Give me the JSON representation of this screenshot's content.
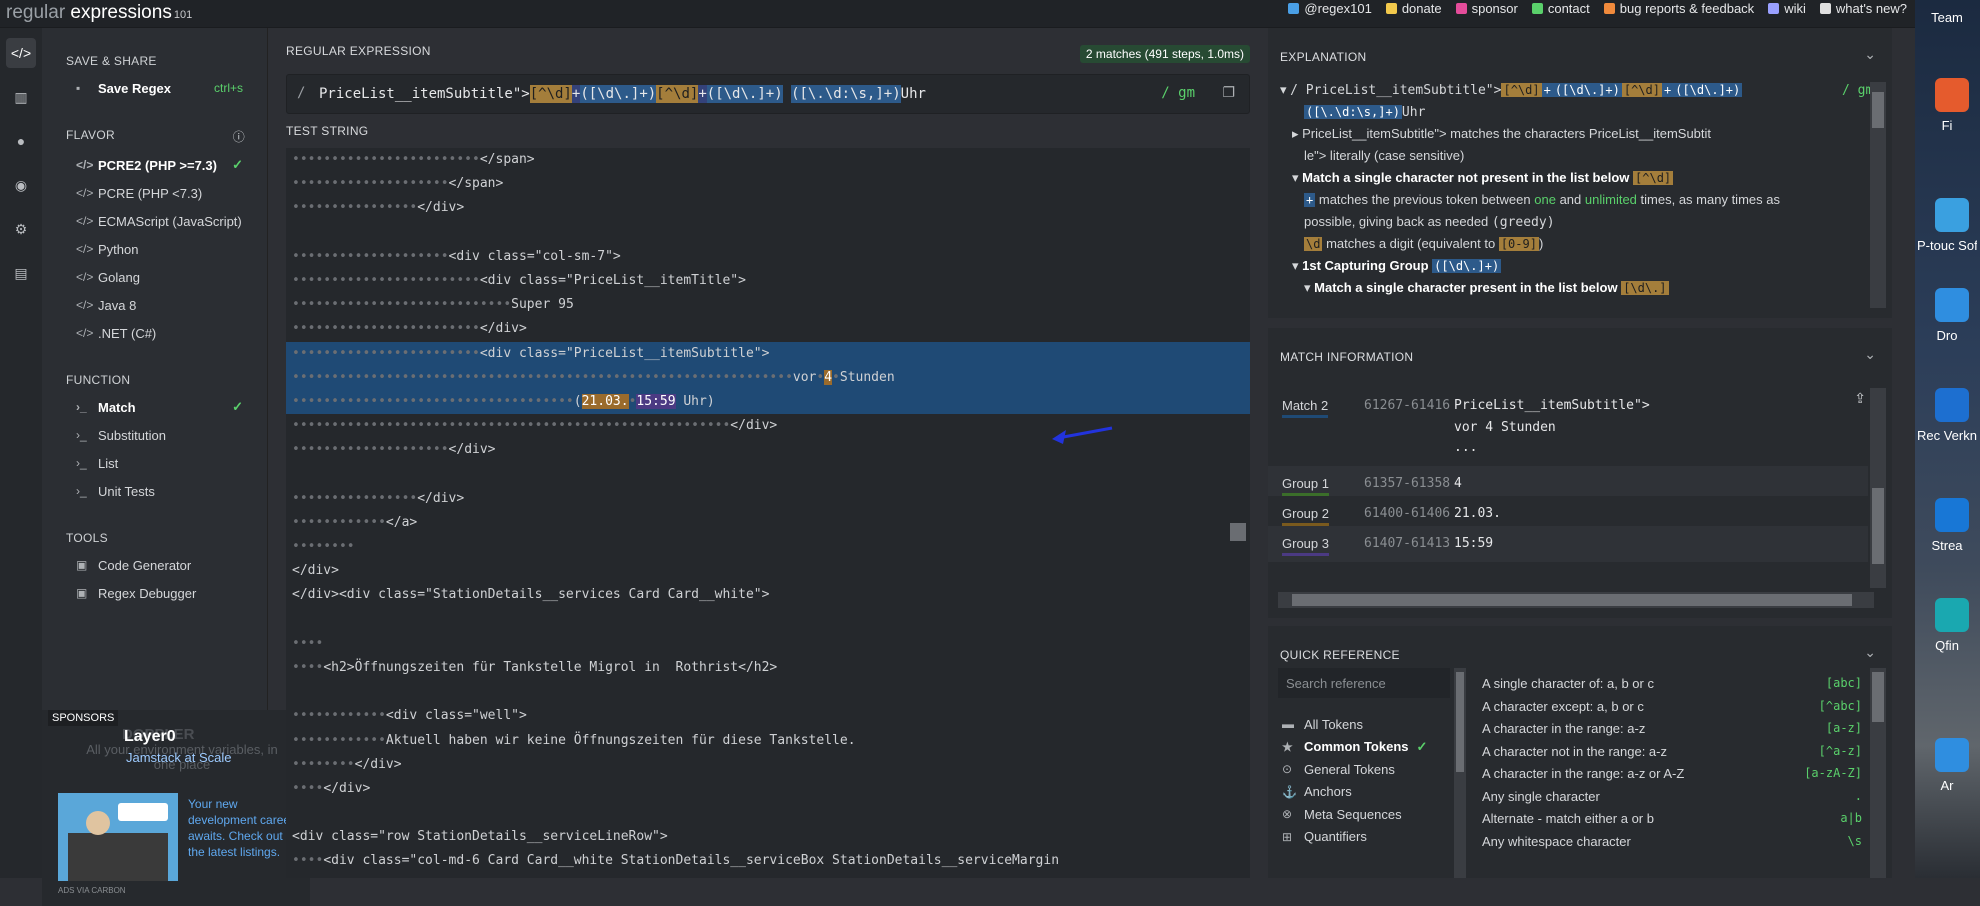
{
  "app": {
    "logo_main": "regular",
    "logo_rest": " expressions",
    "logo_ver": "101"
  },
  "toplinks": [
    {
      "label": "@regex101",
      "icon": "twitter-icon",
      "color": "#4a9fe6"
    },
    {
      "label": "donate",
      "icon": "dollar-icon",
      "color": "#f2c94c"
    },
    {
      "label": "sponsor",
      "icon": "heart-icon",
      "color": "#e44c9a"
    },
    {
      "label": "contact",
      "icon": "mail-icon",
      "color": "#5ad06b"
    },
    {
      "label": "bug reports & feedback",
      "icon": "warning-icon",
      "color": "#f08a3c"
    },
    {
      "label": "wiki",
      "icon": "book-icon",
      "color": "#9aa0ff"
    },
    {
      "label": "what's new?",
      "icon": "megaphone-icon",
      "color": "#e0e0e0"
    }
  ],
  "sidebar": {
    "save_share": "SAVE & SHARE",
    "save_regex": "Save Regex",
    "save_shortcut": "ctrl+s",
    "flavor": "FLAVOR",
    "flavors": [
      "PCRE2 (PHP >=7.3)",
      "PCRE (PHP <7.3)",
      "ECMAScript (JavaScript)",
      "Python",
      "Golang",
      "Java 8",
      ".NET (C#)"
    ],
    "function": "FUNCTION",
    "functions": [
      "Match",
      "Substitution",
      "List",
      "Unit Tests"
    ],
    "tools": "TOOLS",
    "tools_items": [
      "Code Generator",
      "Regex Debugger"
    ],
    "sponsors": "SPONSORS",
    "ad_doppler": "DOPPLER",
    "ad_doppler_text": "All your environment variables, in one place",
    "ad_layer": "Layer0",
    "ad_layer_sub": "Jamstack at Scale",
    "ad_text": "Your new development career awaits. Check out the latest listings.",
    "ad_via": "ADS VIA CARBON"
  },
  "regex": {
    "header": "REGULAR EXPRESSION",
    "badge": "2 matches (491 steps, 1.0ms)",
    "delim": "/",
    "literal": "PriceList__itemSubtitle\">",
    "tok1": "[^\\d]",
    "tok2": "+",
    "tok3": "([\\d\\.]+)",
    "tok4": "[^\\d]",
    "tok5": "+",
    "tok6": "([\\d\\.]+)",
    "tok7": "([\\.\\d:\\s,]+)",
    "tail": "Uhr",
    "flags": "/ gm"
  },
  "test": {
    "header": "TEST STRING",
    "lines": [
      "                        </span>",
      "                    </span>",
      "                </div>",
      "",
      "                    <div class=\"col-sm-7\">",
      "                        <div class=\"PriceList__itemTitle\">",
      "                            Super 95",
      "                        </div>",
      "                        <div class=\"PriceList__itemSubtitle\">",
      "                                                                vor 4 Stunden",
      "                                    (21.03. 15:59 Uhr)",
      "                                                        </div>",
      "                    </div>",
      "",
      "                </div>",
      "            </a>",
      "        ",
      "</div>",
      "</div><div class=\"StationDetails__services Card Card__white\">",
      "",
      "    ",
      "    <h2>Öffnungszeiten für Tankstelle Migrol in  Rothrist</h2>",
      "",
      "            <div class=\"well\">",
      "            Aktuell haben wir keine Öffnungszeiten für diese Tankstelle.",
      "        </div>",
      "    </div>",
      "",
      "<div class=\"row StationDetails__serviceLineRow\">",
      "    <div class=\"col-md-6 Card Card__white StationDetails__serviceBox StationDetails__serviceMargin"
    ]
  },
  "explanation": {
    "header": "EXPLANATION",
    "l1_lit": "/ PriceList__itemSubtitle\">",
    "l1_flags": "/ gm",
    "l2_tok": "([\\.\\d:\\s,]+)",
    "l2_tail": "Uhr",
    "l3": "PriceList__itemSubtitle\"> matches the characters PriceList__itemSubtit",
    "l4": "le\"> literally (case sensitive)",
    "l5": "Match a single character not present in the list below",
    "l5_tok": "[^\\d]",
    "l6_a": "matches the previous token between",
    "l6_one": "one",
    "l6_and": "and",
    "l6_unl": "unlimited",
    "l6_b": "times, as many times as",
    "l7": "possible, giving back as needed",
    "l7_g": "(greedy)",
    "l8_tok": "\\d",
    "l8_a": "matches a digit (equivalent to",
    "l8_r": "[0-9]",
    "l9": "1st Capturing Group",
    "l9_tok": "([\\d\\.]+)",
    "l10": "Match a single character present in the list below",
    "l10_tok": "[\\d\\.]"
  },
  "match_info": {
    "header": "MATCH INFORMATION",
    "rows": [
      {
        "label": "Match 2",
        "range": "61267-61416",
        "value": "PriceList__itemSubtitle\">",
        "value2": "vor 4 Stunden",
        "value3": "..."
      },
      {
        "label": "Group 1",
        "range": "61357-61358",
        "value": "4"
      },
      {
        "label": "Group 2",
        "range": "61400-61406",
        "value": "21.03."
      },
      {
        "label": "Group 3",
        "range": "61407-61413",
        "value": "15:59"
      }
    ]
  },
  "quick_ref": {
    "header": "QUICK REFERENCE",
    "search_placeholder": "Search reference",
    "categories": [
      "All Tokens",
      "Common Tokens",
      "General Tokens",
      "Anchors",
      "Meta Sequences",
      "Quantifiers"
    ],
    "items": [
      {
        "desc": "A single character of: a, b or c",
        "token": "[abc]"
      },
      {
        "desc": "A character except: a, b or c",
        "token": "[^abc]"
      },
      {
        "desc": "A character in the range: a-z",
        "token": "[a-z]"
      },
      {
        "desc": "A character not in the range: a-z",
        "token": "[^a-z]"
      },
      {
        "desc": "A character in the range: a-z or A-Z",
        "token": "[a-zA-Z]"
      },
      {
        "desc": "Any single character",
        "token": "."
      },
      {
        "desc": "Alternate - match either a or b",
        "token": "a|b"
      },
      {
        "desc": "Any whitespace character",
        "token": "\\s"
      }
    ]
  },
  "desktop": [
    "Team",
    "Fi",
    "P-touc Sof",
    "Dro",
    "Rec Verkn",
    "Strea",
    "Qfin",
    "Ar"
  ]
}
